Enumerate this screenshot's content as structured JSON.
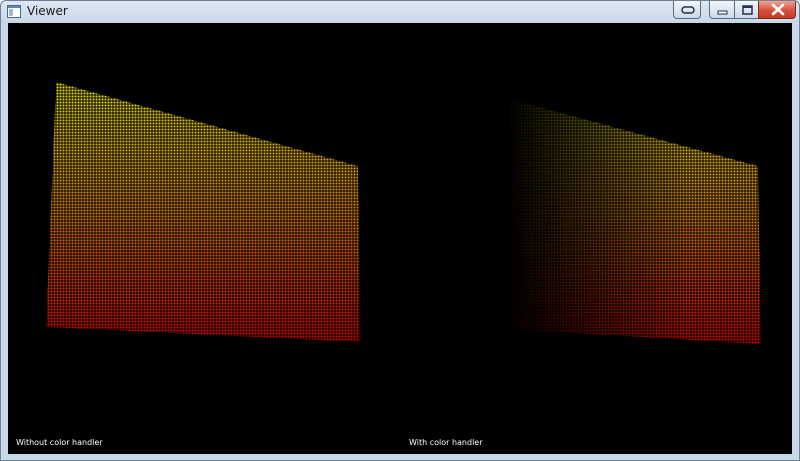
{
  "window": {
    "title": "Viewer",
    "icon": "viewer-app-icon",
    "controls": [
      "restore-icon",
      "minimize-icon",
      "maximize-icon",
      "close-icon"
    ]
  },
  "viewport": {
    "background": "#000000",
    "gradient_colors": {
      "top": "#e6e600",
      "bottom": "#d40000"
    },
    "panes": [
      {
        "label": "Without color handler"
      },
      {
        "label": "With color handler"
      }
    ]
  }
}
